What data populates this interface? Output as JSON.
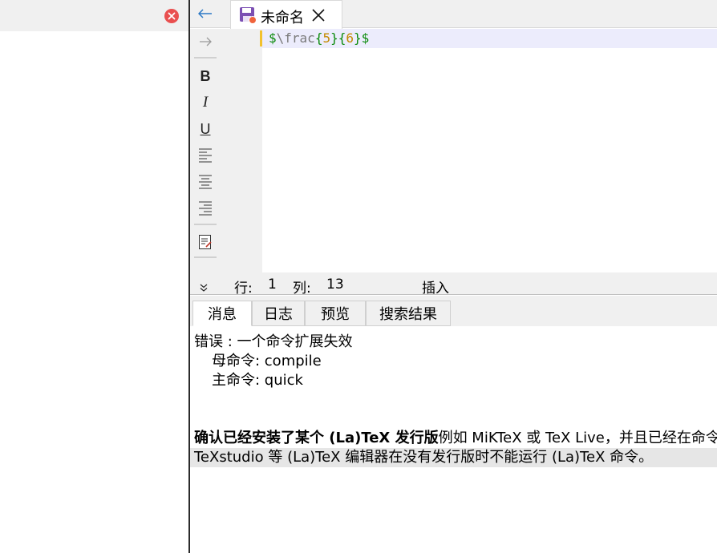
{
  "tab": {
    "title": "未命名"
  },
  "editor": {
    "code": {
      "dollar_open": "$",
      "command": "\\frac",
      "brace1_open": "{",
      "num1": "5",
      "brace1_close": "}",
      "brace2_open": "{",
      "num2": "6",
      "brace2_close": "}",
      "dollar_close": "$"
    }
  },
  "toolbar": {
    "bold": "B",
    "italic": "I",
    "underline": "U"
  },
  "statusbar": {
    "line_label": "行:",
    "line_value": "1",
    "col_label": "列:",
    "col_value": "13",
    "mode": "插入"
  },
  "panel": {
    "tabs": [
      {
        "label": "消息"
      },
      {
        "label": "日志"
      },
      {
        "label": "预览"
      },
      {
        "label": "搜索结果"
      }
    ]
  },
  "messages": {
    "error": "错误 : 一个命令扩展失效",
    "parent": "母命令: compile",
    "main": "主命令: quick",
    "hint_bold": "确认已经安装了某个 (La)TeX 发行版",
    "hint_rest": "例如 MiKTeX 或 TeX Live，并且已经在命令配",
    "hint_line2": "TeXstudio 等 (La)TeX 编辑器在没有发行版时不能运行 (La)TeX 命令。"
  },
  "colors": {
    "accent": "#2b78c5",
    "close": "#e94f4f",
    "math": "#0a8a0a",
    "number": "#c48a00",
    "current_line": "#ececfc"
  }
}
